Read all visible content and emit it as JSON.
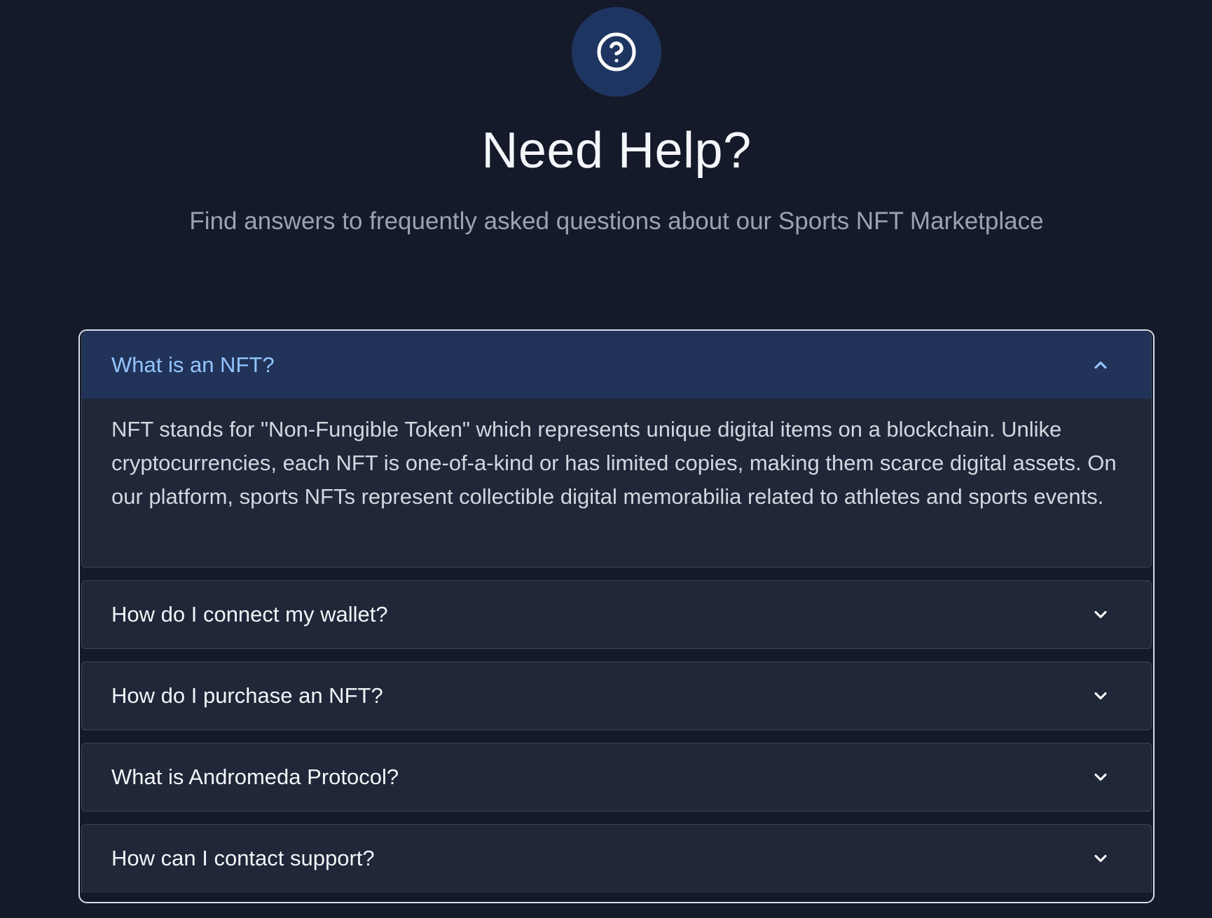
{
  "header": {
    "icon": "question-circle-icon",
    "title": "Need Help?",
    "subtitle": "Find answers to frequently asked questions about our Sports NFT Marketplace"
  },
  "colors": {
    "background": "#141a2a",
    "accent": "#93c5fd",
    "icon_circle": "#1f3561",
    "open_header": "#22335a",
    "item_bg": "#1f2738"
  },
  "faq": {
    "items": [
      {
        "question": "What is an NFT?",
        "expanded": true,
        "icon": "chevron-up-icon",
        "answer": "NFT stands for \"Non-Fungible Token\" which represents unique digital items on a blockchain. Unlike cryptocurrencies, each NFT is one-of-a-kind or has limited copies, making them scarce digital assets. On our platform, sports NFTs represent collectible digital memorabilia related to athletes and sports events."
      },
      {
        "question": "How do I connect my wallet?",
        "expanded": false,
        "icon": "chevron-down-icon"
      },
      {
        "question": "How do I purchase an NFT?",
        "expanded": false,
        "icon": "chevron-down-icon"
      },
      {
        "question": "What is Andromeda Protocol?",
        "expanded": false,
        "icon": "chevron-down-icon"
      },
      {
        "question": "How can I contact support?",
        "expanded": false,
        "icon": "chevron-down-icon"
      }
    ]
  }
}
